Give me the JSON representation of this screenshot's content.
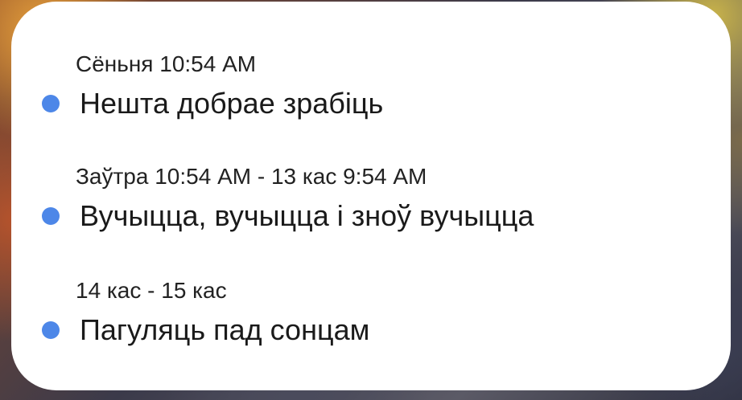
{
  "events": [
    {
      "time": "Сёньня 10:54 AM",
      "title": "Нешта добрае зрабіць",
      "icon": "calendar-dot-icon"
    },
    {
      "time": "Заўтра 10:54 AM - 13 кас 9:54 AM",
      "title": "Вучыцца, вучыцца і зноў вучыцца",
      "icon": "calendar-dot-icon"
    },
    {
      "time": "14 кас - 15 кас",
      "title": "Пагуляць пад сонцам",
      "icon": "calendar-dot-icon"
    }
  ],
  "colors": {
    "dot": "#4d87e8",
    "card": "#ffffff",
    "text": "#1a1a1a"
  }
}
